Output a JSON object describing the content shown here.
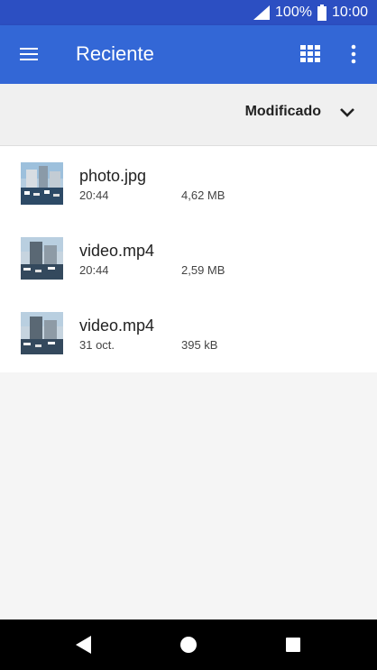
{
  "status_bar": {
    "battery": "100%",
    "time": "10:00"
  },
  "app_bar": {
    "title": "Reciente",
    "icons": {
      "menu": "menu-icon",
      "grid": "grid-view-icon",
      "more": "more-vert-icon"
    }
  },
  "sort": {
    "label": "Modificado",
    "icon": "chevron-down-icon"
  },
  "files": [
    {
      "name": "photo.jpg",
      "date": "20:44",
      "size": "4,62 MB"
    },
    {
      "name": "video.mp4",
      "date": "20:44",
      "size": "2,59 MB"
    },
    {
      "name": "video.mp4",
      "date": "31 oct.",
      "size": "395 kB"
    }
  ],
  "colors": {
    "status_bar": "#2c4fc2",
    "app_bar": "#3367d6",
    "background": "#f5f5f5"
  }
}
